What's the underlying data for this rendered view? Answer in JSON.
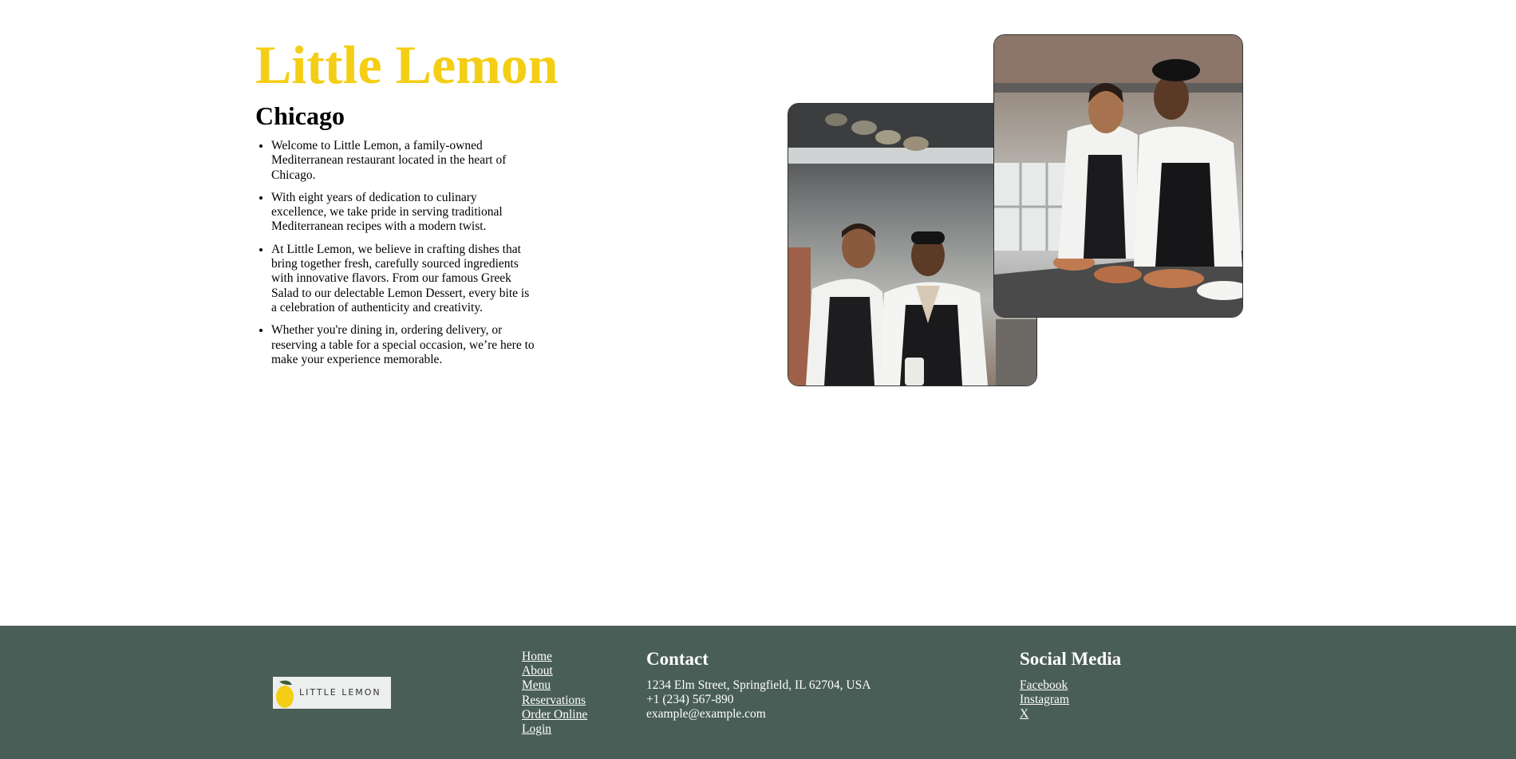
{
  "colors": {
    "brand_yellow": "#F4CE14",
    "footer_green": "#495E57",
    "footer_text": "#FFFFFF"
  },
  "hero": {
    "title": "Little Lemon",
    "subtitle": "Chicago",
    "paragraphs": [
      "Welcome to Little Lemon, a family-owned Mediterranean restaurant located in the heart of Chicago.",
      "With eight years of dedication to culinary excellence, we take pride in serving traditional Mediterranean recipes with a modern twist.",
      "At Little Lemon, we believe in crafting dishes that bring together fresh, carefully sourced ingredients with innovative flavors. From our famous Greek Salad to our delectable Lemon Dessert, every bite is a celebration of authenticity and creativity.",
      "Whether you're dining in, ordering delivery, or reserving a table for a special occasion, we’re here to make your experience memorable."
    ],
    "images": [
      "chefs-smiling-photo",
      "chefs-talking-photo"
    ]
  },
  "footer": {
    "logo_text": "LITTLE LEMON",
    "nav": [
      "Home",
      "About",
      "Menu",
      "Reservations",
      "Order Online",
      "Login"
    ],
    "contact": {
      "heading": "Contact",
      "address": "1234 Elm Street, Springfield, IL 62704, USA",
      "phone": "+1 (234) 567-890",
      "email": "example@example.com"
    },
    "social": {
      "heading": "Social Media",
      "links": [
        "Facebook",
        "Instagram",
        "X"
      ]
    }
  }
}
